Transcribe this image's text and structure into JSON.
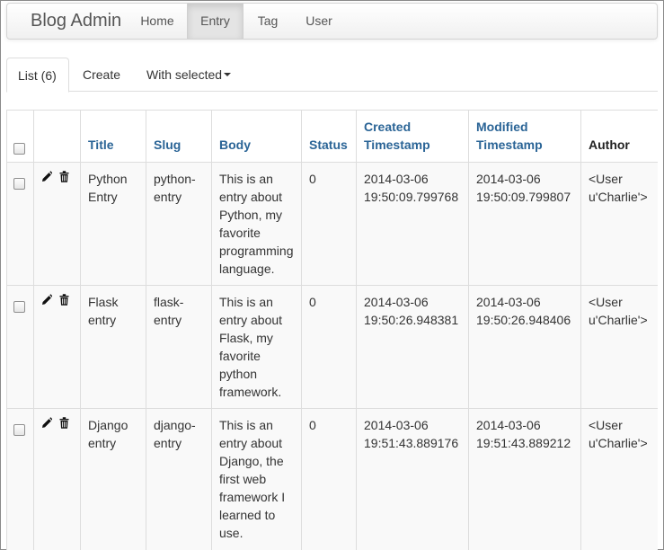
{
  "navbar": {
    "brand": "Blog Admin",
    "items": [
      {
        "label": "Home",
        "active": false
      },
      {
        "label": "Entry",
        "active": true
      },
      {
        "label": "Tag",
        "active": false
      },
      {
        "label": "User",
        "active": false
      }
    ]
  },
  "tabs": {
    "list": "List (6)",
    "create": "Create",
    "with_selected": "With selected"
  },
  "table": {
    "columns": [
      "Title",
      "Slug",
      "Body",
      "Status",
      "Created Timestamp",
      "Modified Timestamp",
      "Author"
    ],
    "rows": [
      {
        "title": "Python Entry",
        "slug": "python-entry",
        "body": "This is an entry about Python, my favorite programming language.",
        "status": "0",
        "created": "2014-03-06 19:50:09.799768",
        "modified": "2014-03-06 19:50:09.799807",
        "author": "<User u'Charlie'>"
      },
      {
        "title": "Flask entry",
        "slug": "flask-entry",
        "body": "This is an entry about Flask, my favorite python framework.",
        "status": "0",
        "created": "2014-03-06 19:50:26.948381",
        "modified": "2014-03-06 19:50:26.948406",
        "author": "<User u'Charlie'>"
      },
      {
        "title": "Django entry",
        "slug": "django-entry",
        "body": "This is an entry about Django, the first web framework I learned to use.",
        "status": "0",
        "created": "2014-03-06 19:51:43.889176",
        "modified": "2014-03-06 19:51:43.889212",
        "author": "<User u'Charlie'>"
      }
    ]
  },
  "colors": {
    "link": "#2a6496",
    "row_bg": "#f9f9f9",
    "border": "#dddddd",
    "active_nav": "#e4e4e4"
  },
  "icons": {
    "edit": "pencil-icon",
    "delete": "trash-icon",
    "dropdown": "caret-down-icon"
  }
}
